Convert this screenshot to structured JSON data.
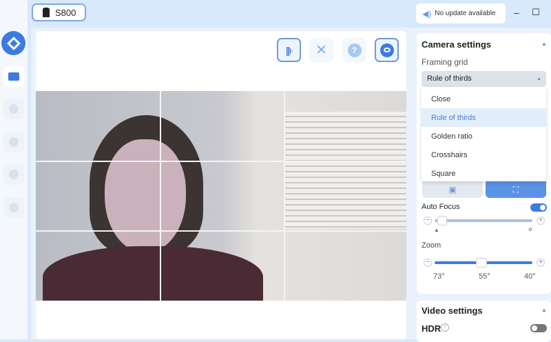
{
  "device": {
    "name": "S800"
  },
  "update": {
    "status": "No update available"
  },
  "window": {
    "minimize": "–",
    "maximize": "☐"
  },
  "toolbar": {
    "icons": [
      "audio-waveform-icon",
      "tools-icon",
      "help-icon",
      "eye-icon"
    ],
    "help_glyph": "?"
  },
  "camera_settings": {
    "title": "Camera settings",
    "framing_grid_label": "Framing grid",
    "framing_grid_value": "Rule of thirds",
    "options": [
      "Close",
      "Rule of thirds",
      "Golden ratio",
      "Crosshairs",
      "Square"
    ],
    "auto_focus_label": "Auto Focus",
    "auto_focus_on": true,
    "focus_value": 0.03,
    "zoom_label": "Zoom",
    "zoom_value": 0.48,
    "zoom_ticks": [
      "73°",
      "55°",
      "40°"
    ]
  },
  "video_settings": {
    "title": "Video settings",
    "hdr_label": "HDR",
    "hdr_on": false
  },
  "colors": {
    "accent": "#3d7be0",
    "topbar": "#d8e9fb"
  }
}
